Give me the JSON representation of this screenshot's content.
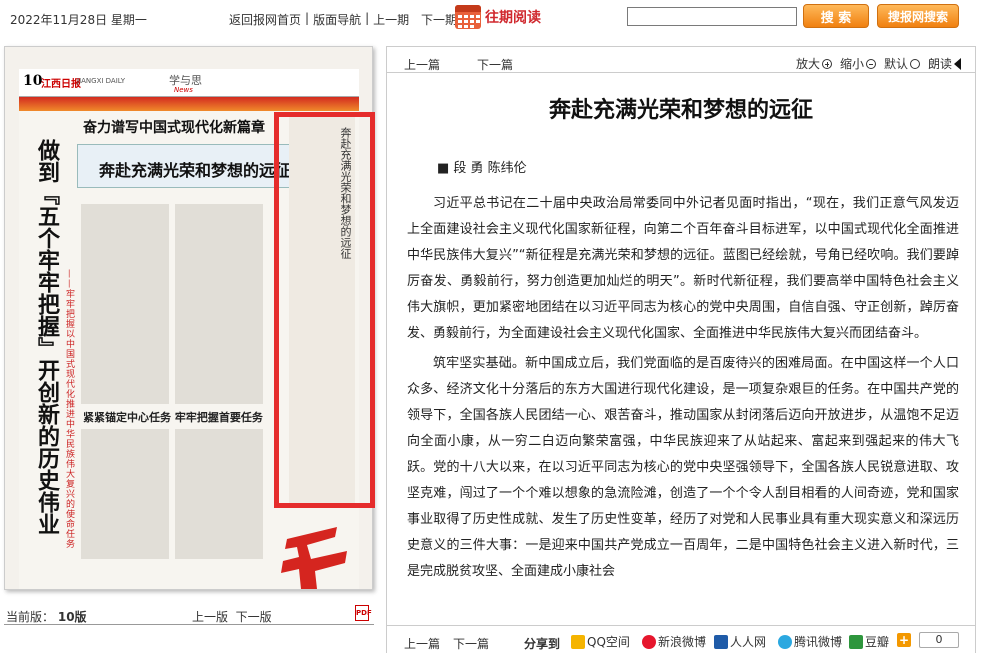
{
  "header": {
    "date": "2022年11月28日 星期一",
    "nav": [
      "返回报网首页",
      "版面导航",
      "上一期",
      "下一期"
    ],
    "past_label": "往期阅读",
    "search_placeholder": "",
    "search_button": "搜 索",
    "site_search_button": "搜报网搜索"
  },
  "paper": {
    "page_num": "10",
    "masthead": "江西日报",
    "masthead_en": "JIANGXI DAILY",
    "section": "学与思",
    "section_en": "News",
    "headline_top": "奋力谱写中国式现代化新篇章",
    "box_title": "奔赴充满光荣和梦想的远征",
    "big_title": "做到『五个牢牢把握』开创新的历史伟业",
    "big_subtitle": "——牢牢把握以中国式现代化推进中华民族伟大复兴的使命任务",
    "head2": "紧紧锚定中心任务 牢牢把握首要任务",
    "right_col_title": "奔赴充满光荣和梦想的远征"
  },
  "left_footer": {
    "current_label": "当前版：",
    "current_value": "10版",
    "prev": "上一版",
    "next": "下一版",
    "pdf": "PDF"
  },
  "article": {
    "prev": "上一篇",
    "next": "下一篇",
    "tools": {
      "zoom_in": "放大",
      "zoom_out": "缩小",
      "default": "默认",
      "read": "朗读"
    },
    "title": "奔赴充满光荣和梦想的远征",
    "author": "■ 段 勇 陈纬伦",
    "paragraphs": [
      "习近平总书记在二十届中央政治局常委同中外记者见面时指出，“现在，我们正意气风发迈上全面建设社会主义现代化国家新征程，向第二个百年奋斗目标进军，以中国式现代化全面推进中华民族伟大复兴”“新征程是充满光荣和梦想的远征。蓝图已经绘就，号角已经吹响。我们要踔厉奋发、勇毅前行，努力创造更加灿烂的明天”。新时代新征程，我们要高举中国特色社会主义伟大旗帜，更加紧密地团结在以习近平同志为核心的党中央周围，自信自强、守正创新，踔厉奋发、勇毅前行，为全面建设社会主义现代化国家、全面推进中华民族伟大复兴而团结奋斗。",
      "筑牢坚实基础。新中国成立后，我们党面临的是百废待兴的困难局面。在中国这样一个人口众多、经济文化十分落后的东方大国进行现代化建设，是一项复杂艰巨的任务。在中国共产党的领导下，全国各族人民团结一心、艰苦奋斗，推动国家从封闭落后迈向开放进步，从温饱不足迈向全面小康，从一穷二白迈向繁荣富强，中华民族迎来了从站起来、富起来到强起来的伟大飞跃。党的十八大以来，在以习近平同志为核心的党中央坚强领导下，全国各族人民锐意进取、攻坚克难，闯过了一个个难以想象的急流险滩，创造了一个个令人刮目相看的人间奇迹，党和国家事业取得了历史性成就、发生了历史性变革，经历了对党和人民事业具有重大现实意义和深远历史意义的三件大事：一是迎来中国共产党成立一百周年，二是中国特色社会主义进入新时代，三是完成脱贫攻坚、全面建成小康社会"
    ],
    "share_label": "分享到",
    "share": [
      "QQ空间",
      "新浪微博",
      "人人网",
      "腾讯微博",
      "豆瓣"
    ],
    "share_count": "0"
  },
  "colors": {
    "accent": "#d0282e",
    "highlight": "#e52c2c",
    "button": "#f08010"
  }
}
